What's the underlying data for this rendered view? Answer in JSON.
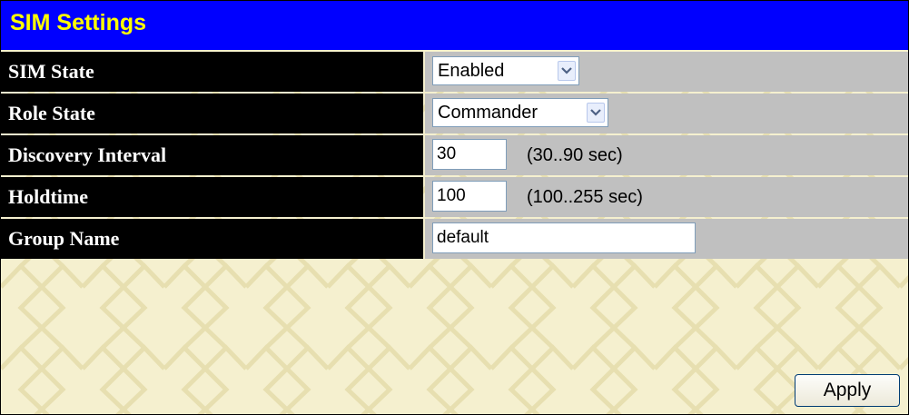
{
  "title": "SIM Settings",
  "colors": {
    "title_bg": "#0000ff",
    "title_text": "#ffff00",
    "label_bg": "#000000",
    "value_bg": "#c0c0c0",
    "pattern_bg": "#f5f0cf"
  },
  "fields": {
    "sim_state": {
      "label": "SIM State",
      "value": "Enabled"
    },
    "role_state": {
      "label": "Role State",
      "value": "Commander"
    },
    "discovery_interval": {
      "label": "Discovery Interval",
      "value": "30",
      "hint": "(30..90 sec)"
    },
    "holdtime": {
      "label": "Holdtime",
      "value": "100",
      "hint": "(100..255 sec)"
    },
    "group_name": {
      "label": "Group Name",
      "value": "default"
    }
  },
  "apply_button": "Apply"
}
